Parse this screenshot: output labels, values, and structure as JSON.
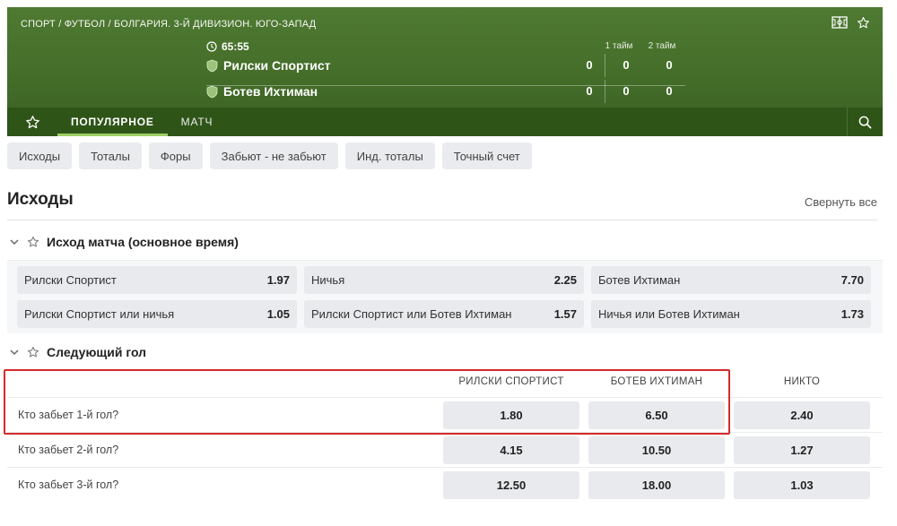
{
  "header": {
    "breadcrumb": "СПОРТ / ФУТБОЛ / БОЛГАРИЯ. 3-Й ДИВИЗИОН. ЮГО-ЗАПАД",
    "match_time": "65:55",
    "half_labels": [
      "1 тайм",
      "2 тайм"
    ],
    "teams": [
      {
        "name": "Рилски Спортист",
        "score": "0",
        "half1": "0",
        "half2": "0"
      },
      {
        "name": "Ботев Ихтиман",
        "score": "0",
        "half1": "0",
        "half2": "0"
      }
    ],
    "icons": [
      "field-icon",
      "star-icon"
    ]
  },
  "nav": {
    "tabs": [
      {
        "label": "ПОПУЛЯРНОЕ",
        "active": true
      },
      {
        "label": "МАТЧ",
        "active": false
      }
    ]
  },
  "filters": [
    "Исходы",
    "Тоталы",
    "Форы",
    "Забьют - не забьют",
    "Инд. тоталы",
    "Точный счет"
  ],
  "section": {
    "title": "Исходы",
    "collapse_all": "Свернуть все"
  },
  "match_result": {
    "title": "Исход матча (основное время)",
    "rows": [
      [
        {
          "label": "Рилски Спортист",
          "odd": "1.97"
        },
        {
          "label": "Ничья",
          "odd": "2.25"
        },
        {
          "label": "Ботев Ихтиман",
          "odd": "7.70"
        }
      ],
      [
        {
          "label": "Рилски Спортист или ничья",
          "odd": "1.05"
        },
        {
          "label": "Рилски Спортист или Ботев Ихтиман",
          "odd": "1.57"
        },
        {
          "label": "Ничья или Ботев Ихтиман",
          "odd": "1.73"
        }
      ]
    ]
  },
  "next_goal": {
    "title": "Следующий гол",
    "columns": [
      "РИЛСКИ СПОРТИСТ",
      "БОТЕВ ИХТИМАН",
      "НИКТО"
    ],
    "rows": [
      {
        "label": "Кто забьет 1-й гол?",
        "odds": [
          "1.80",
          "6.50",
          "2.40"
        ]
      },
      {
        "label": "Кто забьет 2-й гол?",
        "odds": [
          "4.15",
          "10.50",
          "1.27"
        ]
      },
      {
        "label": "Кто забьет 3-й гол?",
        "odds": [
          "12.50",
          "18.00",
          "1.03"
        ]
      }
    ]
  },
  "colors": {
    "header_green": "#4a7430",
    "nav_green": "#2f5418",
    "active_tab_underline": "#9ccf62",
    "highlight_red": "#d32a2a"
  }
}
